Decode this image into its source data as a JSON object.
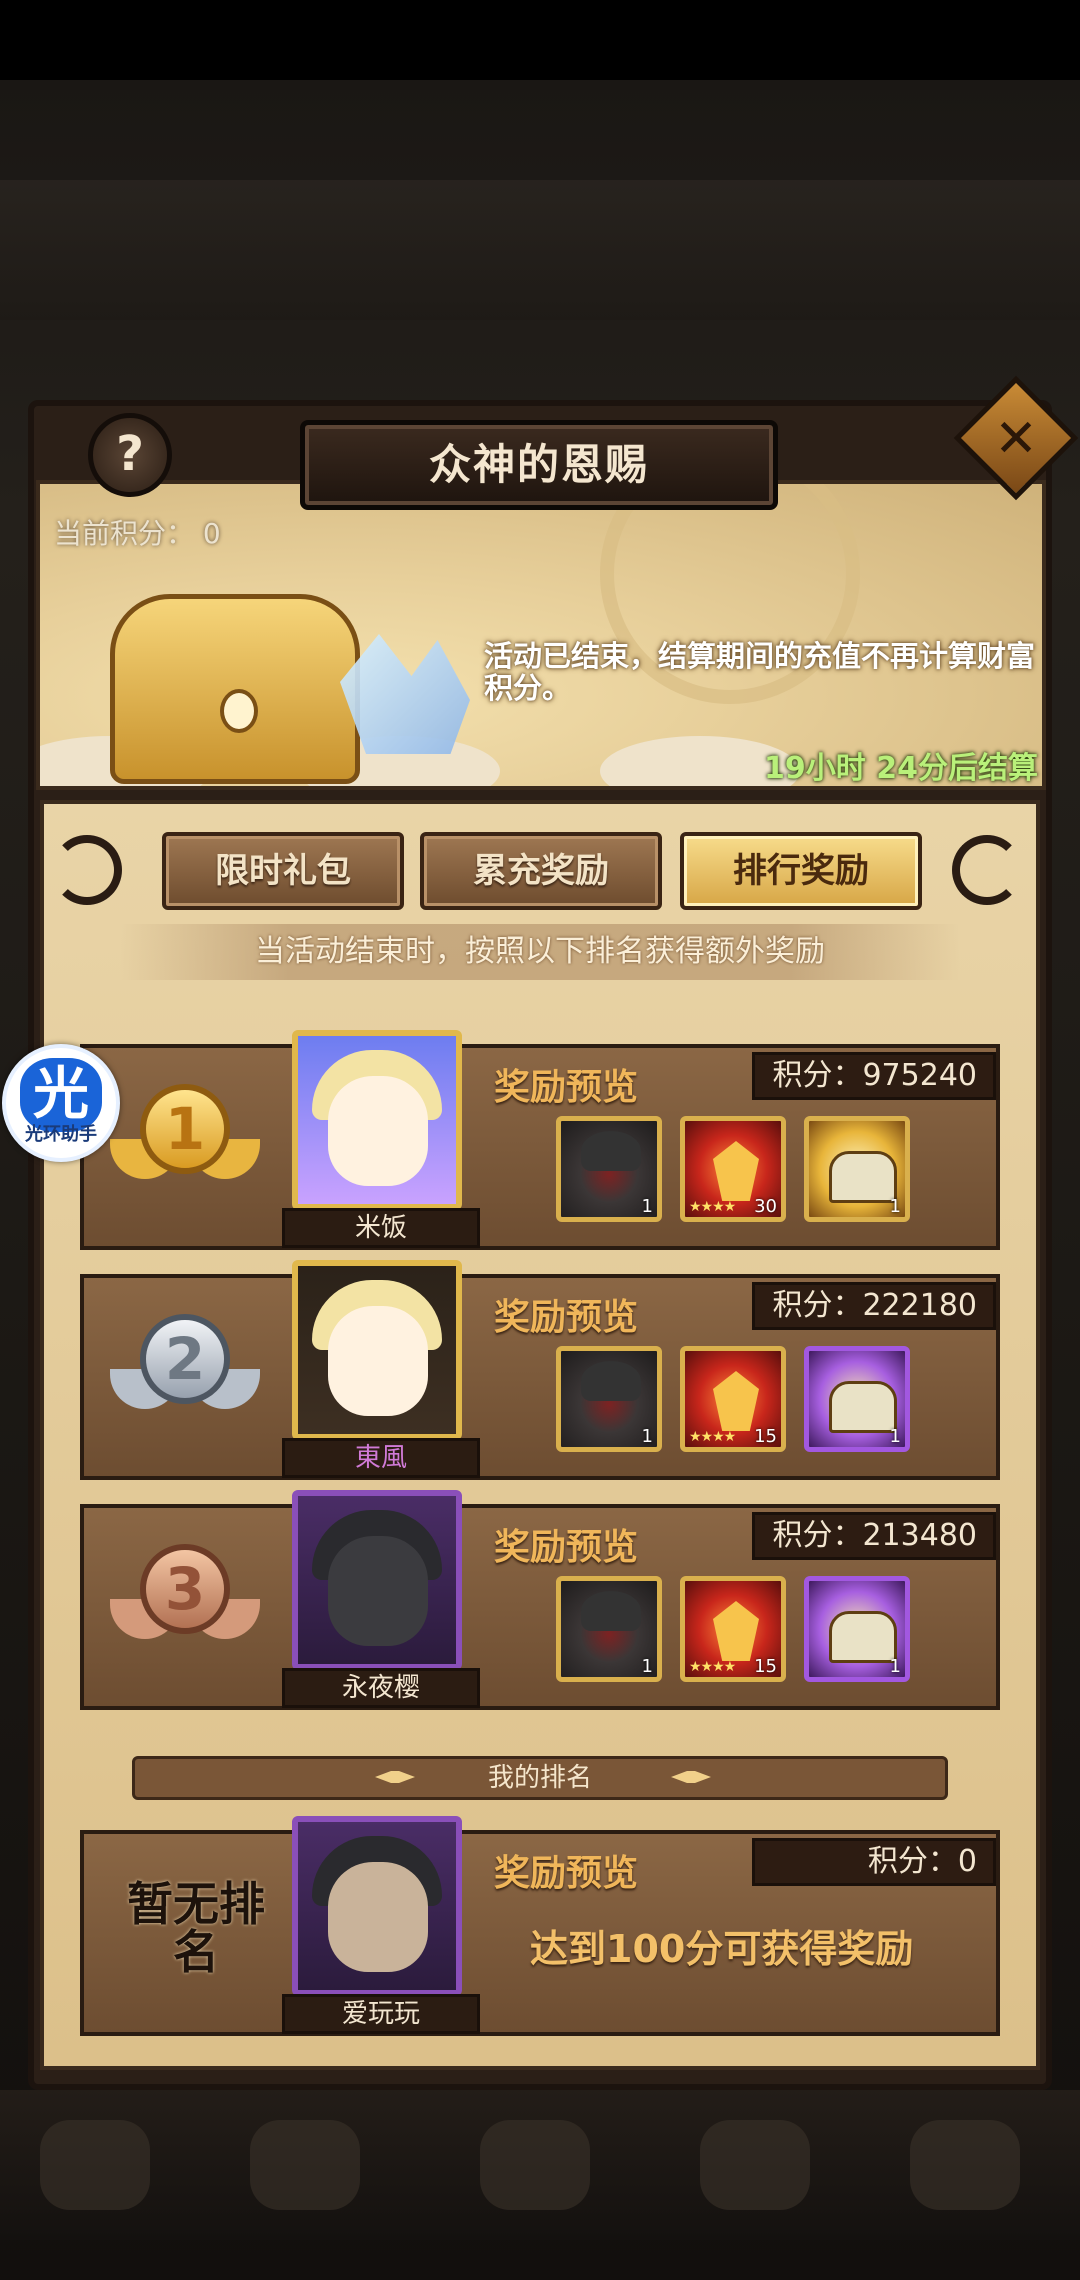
{
  "header": {
    "title": "众神的恩赐",
    "help_icon": "question-icon",
    "close_icon": "close-icon"
  },
  "banner": {
    "current_score_label": "当前积分：",
    "current_score_value": "0",
    "notice": "活动已结束，结算期间的充值不再计算财富积分。",
    "countdown": "19小时 24分后结算"
  },
  "tabs": [
    {
      "label": "限时礼包",
      "active": false
    },
    {
      "label": "累充奖励",
      "active": false
    },
    {
      "label": "排行奖励",
      "active": true
    }
  ],
  "subtitle": "当活动结束时，按照以下排名获得额外奖励",
  "rankings": [
    {
      "rank": "1",
      "name": "米饭",
      "preview_label": "奖励预览",
      "score": "积分：975240",
      "rewards": [
        {
          "icon": "helm-icon",
          "qty": "1",
          "stars": ""
        },
        {
          "icon": "rune-icon",
          "qty": "30",
          "stars": "★★★★"
        },
        {
          "icon": "gold-chest-icon",
          "qty": "1",
          "stars": ""
        }
      ]
    },
    {
      "rank": "2",
      "name": "東風",
      "preview_label": "奖励预览",
      "score": "积分：222180",
      "rewards": [
        {
          "icon": "helm-icon",
          "qty": "1",
          "stars": ""
        },
        {
          "icon": "rune-icon",
          "qty": "15",
          "stars": "★★★★"
        },
        {
          "icon": "purple-chest-icon",
          "qty": "1",
          "stars": ""
        }
      ]
    },
    {
      "rank": "3",
      "name": "永夜樱",
      "preview_label": "奖励预览",
      "score": "积分：213480",
      "rewards": [
        {
          "icon": "helm-icon",
          "qty": "1",
          "stars": ""
        },
        {
          "icon": "rune-icon",
          "qty": "15",
          "stars": "★★★★"
        },
        {
          "icon": "purple-chest-icon",
          "qty": "1",
          "stars": ""
        }
      ]
    }
  ],
  "my_rank": {
    "section_label": "我的排名",
    "rank_text": "暂无排名",
    "name": "爱玩玩",
    "preview_label": "奖励预览",
    "score": "积分：0",
    "hint": "达到100分可获得奖励"
  },
  "assistant": {
    "glyph": "光",
    "label": "光环助手"
  }
}
